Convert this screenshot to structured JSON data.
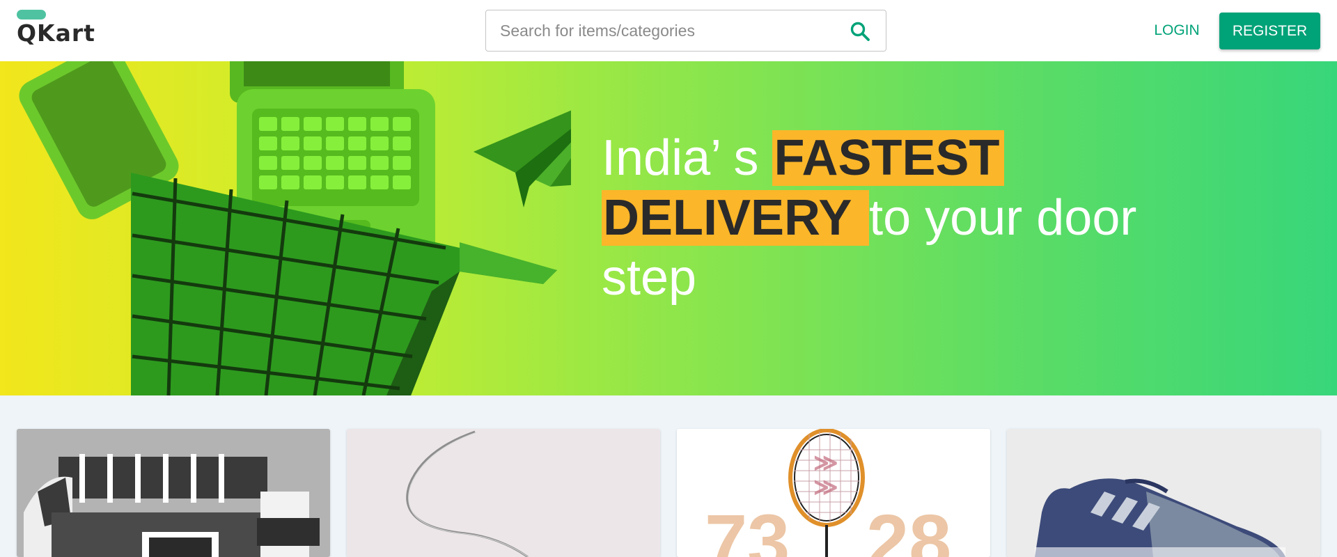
{
  "header": {
    "logo_text": "QKart",
    "search_placeholder": "Search for items/categories",
    "search_icon": "search-icon",
    "login_label": "LOGIN",
    "register_label": "REGISTER"
  },
  "hero": {
    "line1_pre": "India’ s ",
    "line1_highlight": "FASTEST",
    "line2_highlight": "DELIVERY ",
    "line2_post": " to your door",
    "line3": "step"
  },
  "products": {
    "cards": [
      {
        "name": "sofa"
      },
      {
        "name": "necklace"
      },
      {
        "name": "badminton-racket"
      },
      {
        "name": "sneaker"
      }
    ],
    "racket_card_text_left": "73",
    "racket_card_text_right": "28"
  },
  "colors": {
    "brand": "#00a278",
    "highlight": "#fbb629",
    "logo_pill": "#4fc3a1"
  }
}
